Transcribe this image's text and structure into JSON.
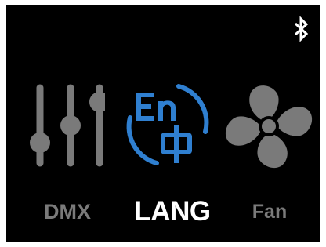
{
  "status_bar": {
    "bluetooth_icon": "bluetooth-icon"
  },
  "menu": {
    "items": [
      {
        "label": "DMX",
        "icon": "sliders-icon",
        "selected": false
      },
      {
        "label": "LANG",
        "icon": "language-en-zh-icon",
        "selected": true,
        "icon_text_top": "En",
        "icon_text_bottom": "中"
      },
      {
        "label": "Fan",
        "icon": "fan-icon",
        "selected": false
      }
    ]
  },
  "colors": {
    "background": "#000000",
    "selected_label": "#ffffff",
    "inactive": "#7a7a7a",
    "accent": "#2f7fd0"
  }
}
